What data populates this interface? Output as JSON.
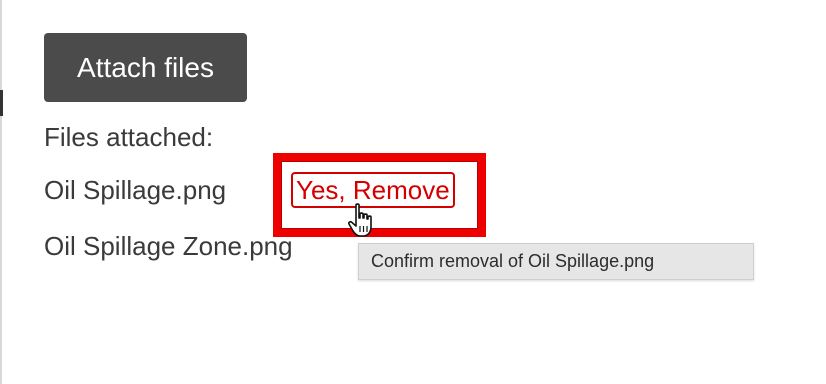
{
  "buttons": {
    "attach_label": "Attach files"
  },
  "attachments": {
    "header": "Files attached:",
    "files": [
      {
        "name": "Oil Spillage.png",
        "confirm_label": "Yes, Remove"
      },
      {
        "name": "Oil Spillage Zone.png",
        "trailing": "–"
      }
    ]
  },
  "tooltip": {
    "text": "Confirm removal of Oil Spillage.png"
  },
  "colors": {
    "button_bg": "#4b4b4b",
    "danger": "#d40000",
    "highlight": "#ee0000",
    "tooltip_bg": "#e6e6e6"
  },
  "icons": {
    "cursor": "hand-pointer-icon"
  }
}
